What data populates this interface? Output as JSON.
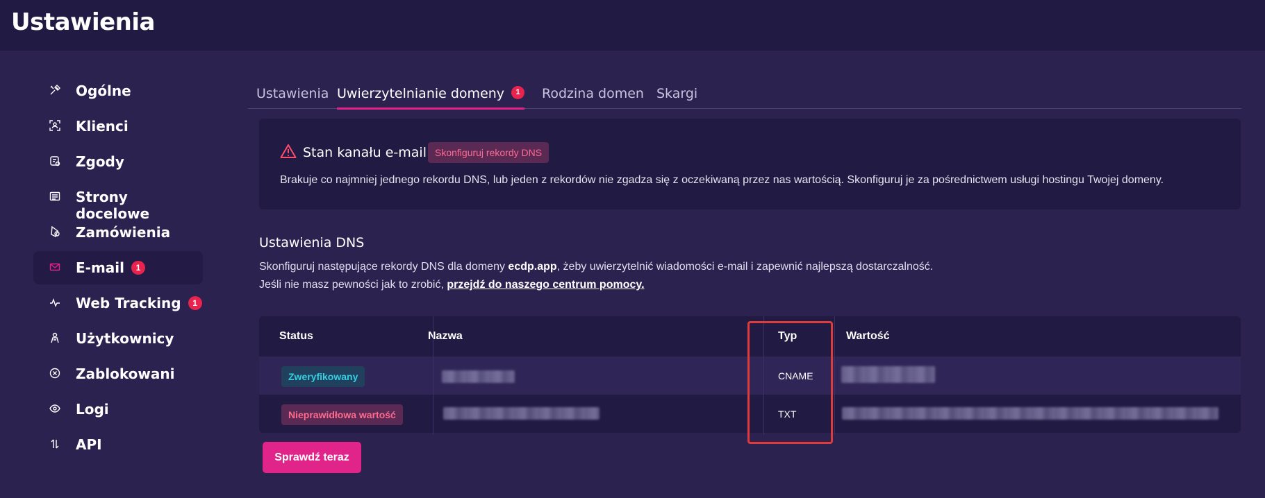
{
  "header": {
    "title": "Ustawienia"
  },
  "sidebar": {
    "items": [
      {
        "label": "Ogólne",
        "icon": "tools-icon"
      },
      {
        "label": "Klienci",
        "icon": "person-frame-icon"
      },
      {
        "label": "Zgody",
        "icon": "consent-icon"
      },
      {
        "label": "Strony docelowe",
        "icon": "page-icon"
      },
      {
        "label": "Zamówienia",
        "icon": "coin-icon"
      },
      {
        "label": "E-mail",
        "icon": "mail-icon",
        "badge": "1",
        "active": true
      },
      {
        "label": "Web Tracking",
        "icon": "activity-icon",
        "badge": "1"
      },
      {
        "label": "Użytkownicy",
        "icon": "users-icon"
      },
      {
        "label": "Zablokowani",
        "icon": "blocked-icon"
      },
      {
        "label": "Logi",
        "icon": "eye-icon"
      },
      {
        "label": "API",
        "icon": "arrows-icon"
      }
    ]
  },
  "tabs": [
    {
      "label": "Ustawienia"
    },
    {
      "label": "Uwierzytelnianie domeny",
      "badge": "1",
      "active": true
    },
    {
      "label": "Rodzina domen"
    },
    {
      "label": "Skargi"
    }
  ],
  "alert": {
    "title": "Stan kanału e-mail",
    "chip": "Skonfiguruj rekordy DNS",
    "text": "Brakuje co najmniej jednego rekordu DNS, lub jeden z rekordów nie zgadza się z oczekiwaną przez nas wartością. Skonfiguruj je za pośrednictwem usługi hostingu Twojej domeny."
  },
  "dns": {
    "title": "Ustawienia DNS",
    "desc_prefix": "Skonfiguruj następujące rekordy DNS dla domeny ",
    "domain": "ecdp.app",
    "desc_suffix": ", żeby uwierzytelnić wiadomości e-mail i zapewnić najlepszą dostarczalność.",
    "help_prefix": "Jeśli nie masz pewności jak to zrobić, ",
    "help_link": "przejdź do naszego centrum pomocy."
  },
  "table": {
    "headers": {
      "status": "Status",
      "name": "Nazwa",
      "type": "Typ",
      "value": "Wartość"
    },
    "rows": [
      {
        "status": "Zweryfikowany",
        "status_kind": "ok",
        "type": "CNAME"
      },
      {
        "status": "Nieprawidłowa wartość",
        "status_kind": "bad",
        "type": "TXT"
      }
    ]
  },
  "actions": {
    "check_now": "Sprawdź teraz"
  },
  "colors": {
    "background": "#2c2250",
    "panel": "#211a42",
    "accent": "#e0248a",
    "badge": "#e8244e",
    "ok": "#33d0e0",
    "error": "#ff6a8f",
    "highlight": "#e03b3b"
  }
}
